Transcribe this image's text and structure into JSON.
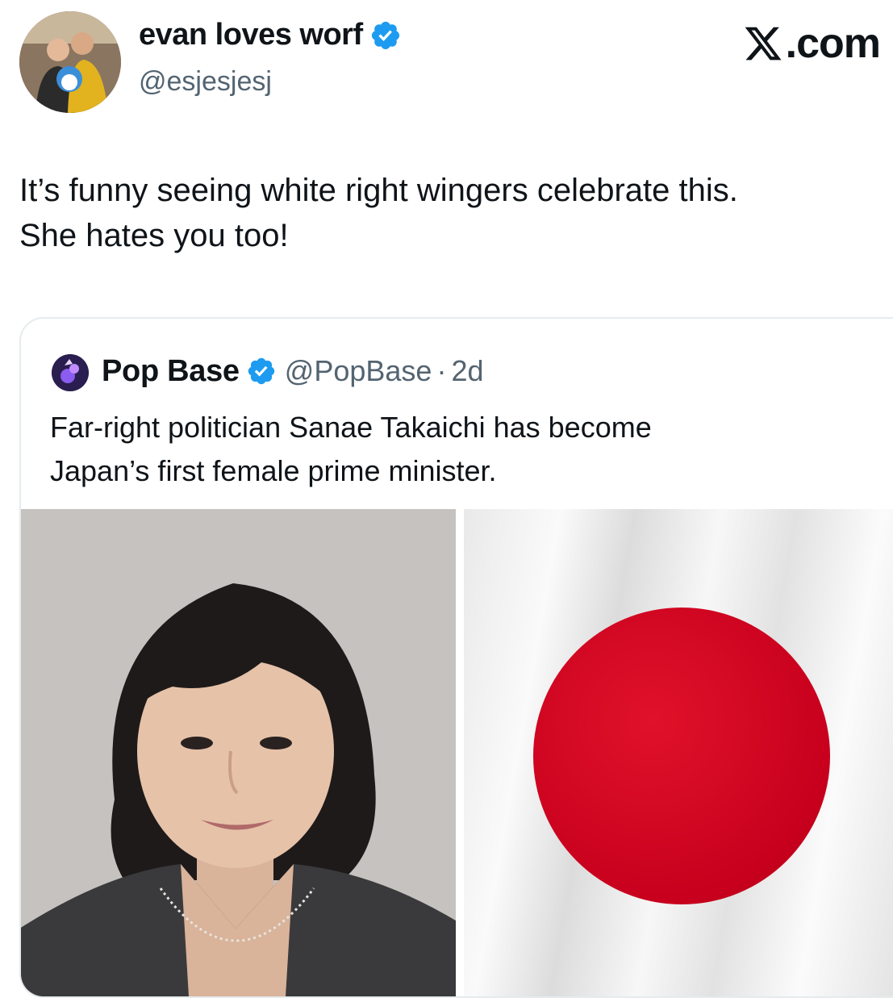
{
  "author": {
    "display_name": "evan loves worf",
    "handle": "@esjesjesj",
    "verified_icon": "verified-badge-icon"
  },
  "brand": {
    "label": ".com",
    "icon": "x-logo-icon"
  },
  "tweet": {
    "text_line1": "It’s funny seeing white right wingers celebrate this.",
    "text_line2": "She hates you too!"
  },
  "quoted": {
    "display_name": "Pop Base",
    "handle": "@PopBase",
    "separator": "·",
    "time": "2d",
    "text_line1": "Far-right politician Sanae Takaichi has become",
    "text_line2": "Japan’s first female prime minister.",
    "media": [
      "portrait photo",
      "Japanese flag"
    ]
  },
  "colors": {
    "verified": "#1d9bf0",
    "flag_red": "#c8001d",
    "secondary_text": "#536471"
  }
}
